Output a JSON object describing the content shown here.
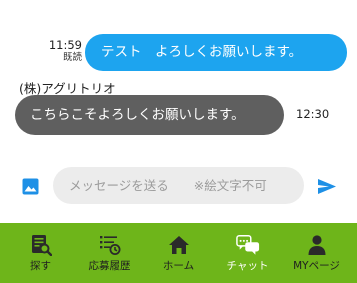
{
  "messages": {
    "outgoing": {
      "time": "11:59",
      "read_status": "既読",
      "text": "テスト　よろしくお願いします。"
    },
    "incoming": {
      "sender": "(株)アグリトリオ",
      "text": "こちらこそよろしくお願いします。",
      "time": "12:30"
    }
  },
  "composer": {
    "placeholder": "メッセージを送る　　※絵文字不可",
    "image_icon": "image-icon",
    "send_icon": "send-icon"
  },
  "nav": {
    "items": [
      {
        "label": "探す",
        "icon": "search-list-icon",
        "active": false
      },
      {
        "label": "応募履歴",
        "icon": "history-icon",
        "active": false
      },
      {
        "label": "ホーム",
        "icon": "home-icon",
        "active": false
      },
      {
        "label": "チャット",
        "icon": "chat-icon",
        "active": true
      },
      {
        "label": "MYページ",
        "icon": "person-icon",
        "active": false
      }
    ]
  },
  "colors": {
    "outgoing_bubble": "#1da4ef",
    "incoming_bubble": "#5f5f5f",
    "nav_background": "#6eb51a",
    "accent": "#1e90e6"
  }
}
